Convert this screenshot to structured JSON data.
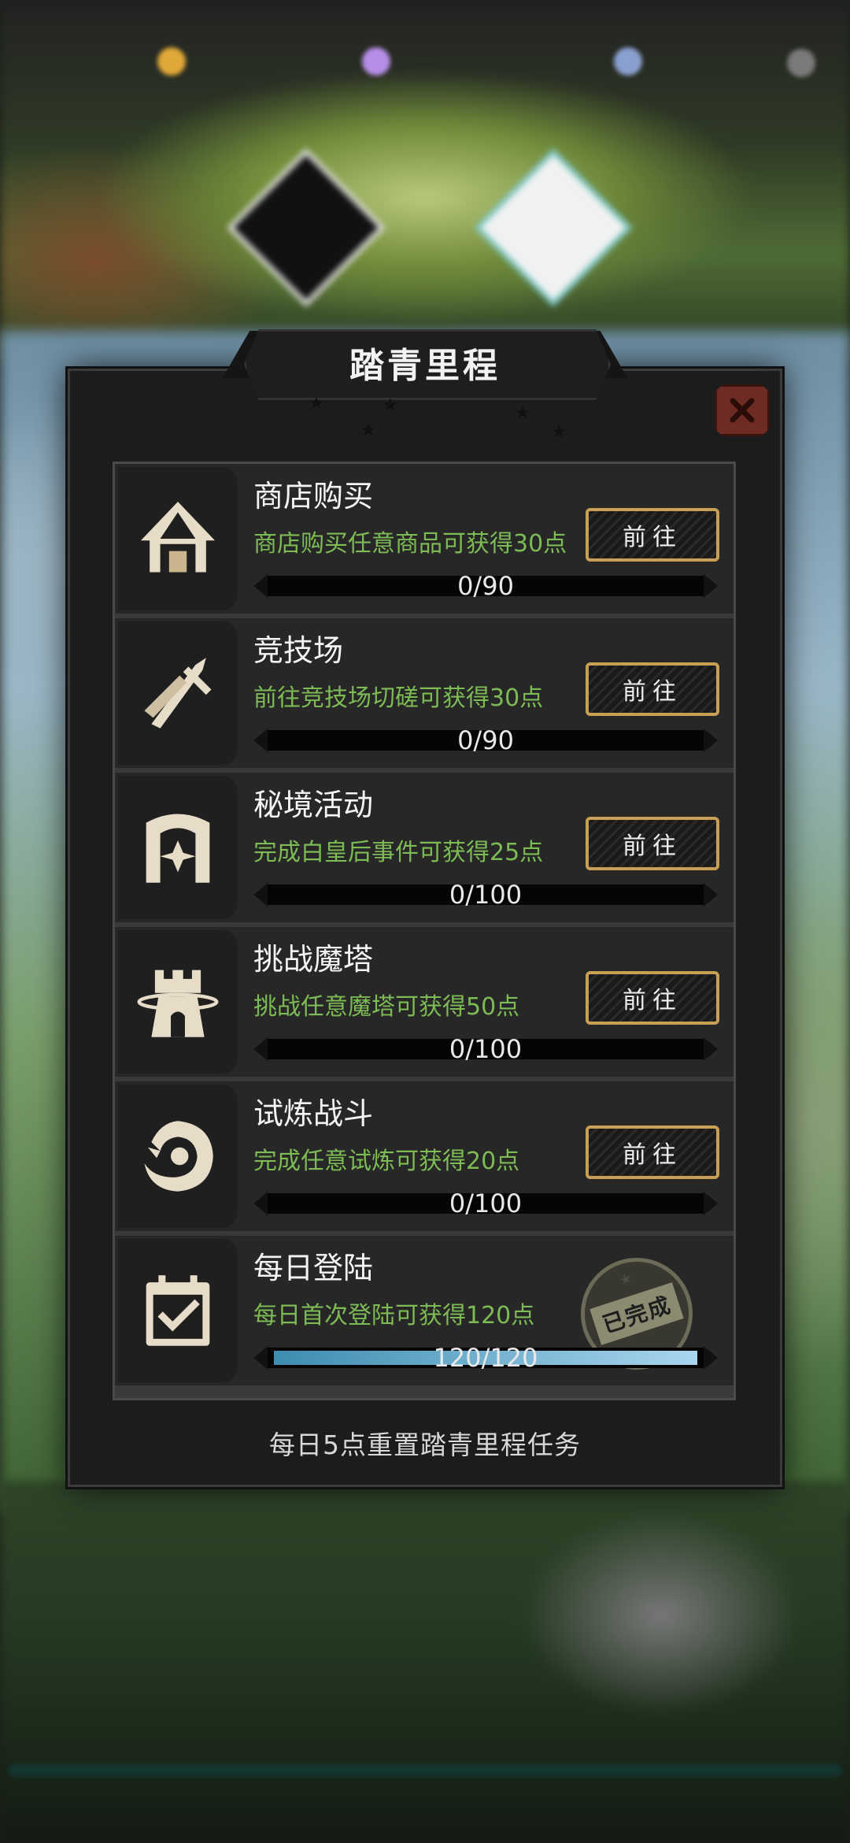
{
  "title": "踏青里程",
  "colors": {
    "accent_gold": "#c8a054",
    "desc_green": "#7dbb55",
    "close_red": "#6e2b24",
    "progress_blue": "#6fb3d8"
  },
  "tasks": [
    {
      "name": "商店购买",
      "desc": "商店购买任意商品可获得30点",
      "button": "前往",
      "progress": "0/90",
      "fraction": 0,
      "icon": "shop-tent-icon",
      "done": false
    },
    {
      "name": "竞技场",
      "desc": "前往竞技场切磋可获得30点",
      "button": "前往",
      "progress": "0/90",
      "fraction": 0,
      "icon": "crossed-swords-icon",
      "done": false
    },
    {
      "name": "秘境活动",
      "desc": "完成白皇后事件可获得25点",
      "button": "前往",
      "progress": "0/100",
      "fraction": 0,
      "icon": "mystic-gate-icon",
      "done": false
    },
    {
      "name": "挑战魔塔",
      "desc": "挑战任意魔塔可获得50点",
      "button": "前往",
      "progress": "0/100",
      "fraction": 0,
      "icon": "tower-icon",
      "done": false
    },
    {
      "name": "试炼战斗",
      "desc": "完成任意试炼可获得20点",
      "button": "前往",
      "progress": "0/100",
      "fraction": 0,
      "icon": "dragon-icon",
      "done": false
    },
    {
      "name": "每日登陆",
      "desc": "每日首次登陆可获得120点",
      "button": "",
      "progress": "120/120",
      "fraction": 1,
      "icon": "calendar-check-icon",
      "done": true,
      "stamp": "已完成"
    }
  ],
  "footer": "每日5点重置踏青里程任务"
}
